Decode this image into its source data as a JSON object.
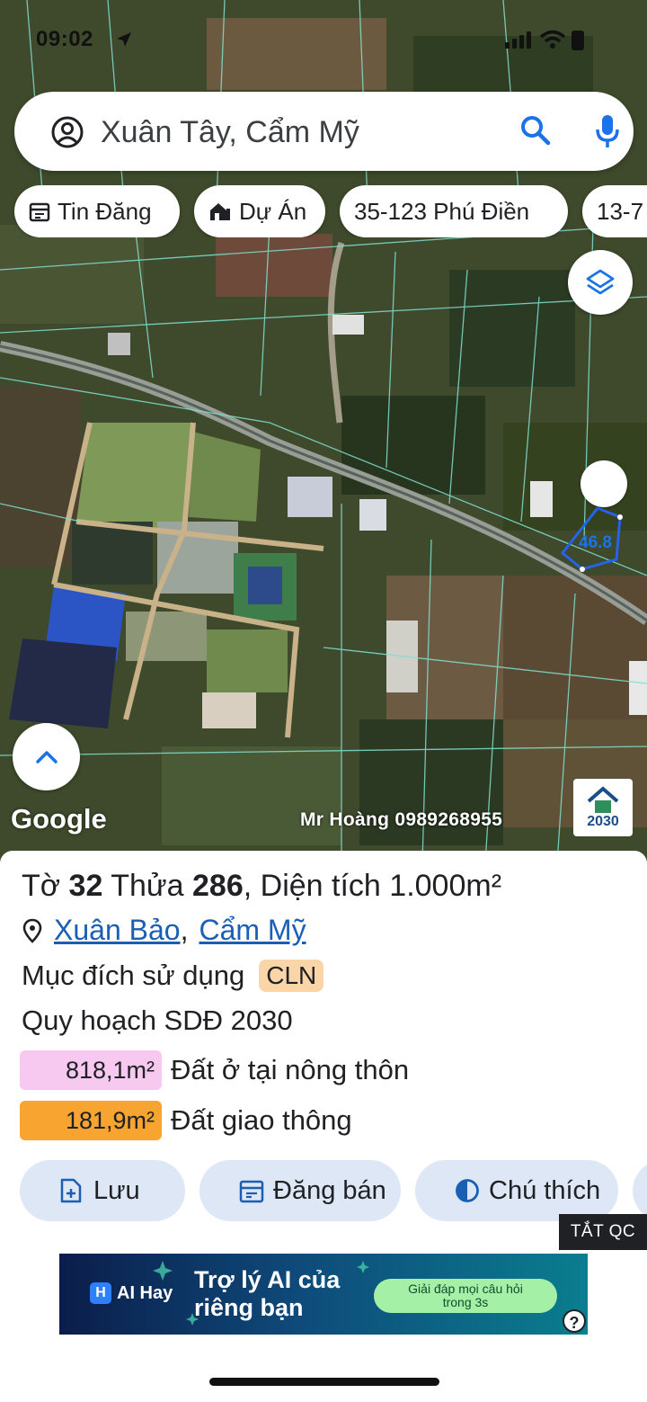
{
  "status_bar": {
    "time": "09:02"
  },
  "search": {
    "query": "Xuân Tây, Cẩm Mỹ"
  },
  "chips": [
    {
      "label": "Tin Đăng",
      "icon": "calendar-icon"
    },
    {
      "label": "Dự Án",
      "icon": "house-icon"
    },
    {
      "label": "35-123 Phú Điền",
      "icon": ""
    },
    {
      "label": "13-7",
      "icon": ""
    }
  ],
  "map": {
    "dimension_label": "46.8",
    "google_logo": "Google",
    "watermark": "Mr Hoàng 0989268955",
    "watermark_logo_year": "2030"
  },
  "parcel": {
    "title_prefix": "Tờ",
    "sheet": "32",
    "plot_prefix": "Thửa",
    "plot": "286",
    "area_prefix": ", Diện tích",
    "area": "1.000",
    "area_unit": "m²",
    "address_ward": "Xuân Bảo",
    "address_sep": ",",
    "address_district": "Cẩm Mỹ",
    "purpose_label": "Mục đích sử dụng",
    "purpose_code": "CLN",
    "plan_label": "Quy hoạch SDĐ 2030",
    "zones": [
      {
        "value": "818,1m²",
        "label": "Đất ở tại nông thôn",
        "color": "#f7c8f0"
      },
      {
        "value": "181,9m²",
        "label": "Đất giao thông",
        "color": "#f8a431"
      }
    ]
  },
  "actions": [
    {
      "label": "Lưu",
      "icon": "bookmark-add-icon"
    },
    {
      "label": "Đăng bán",
      "icon": "calendar-icon"
    },
    {
      "label": "Chú thích",
      "icon": "contrast-icon"
    }
  ],
  "hide_ads_label": "TẮT QC",
  "ad": {
    "brand": "AI Hay",
    "headline_line1": "Trợ lý AI của",
    "headline_line2": "riêng bạn",
    "cta_line1": "Giải đáp mọi câu hỏi",
    "cta_line2": "trong 3s",
    "help": "?"
  },
  "colors": {
    "accent": "#1a73e8",
    "link": "#1a5fb4",
    "action_bg": "#dde7f6",
    "purpose_tag_bg": "#f9d5a8"
  }
}
